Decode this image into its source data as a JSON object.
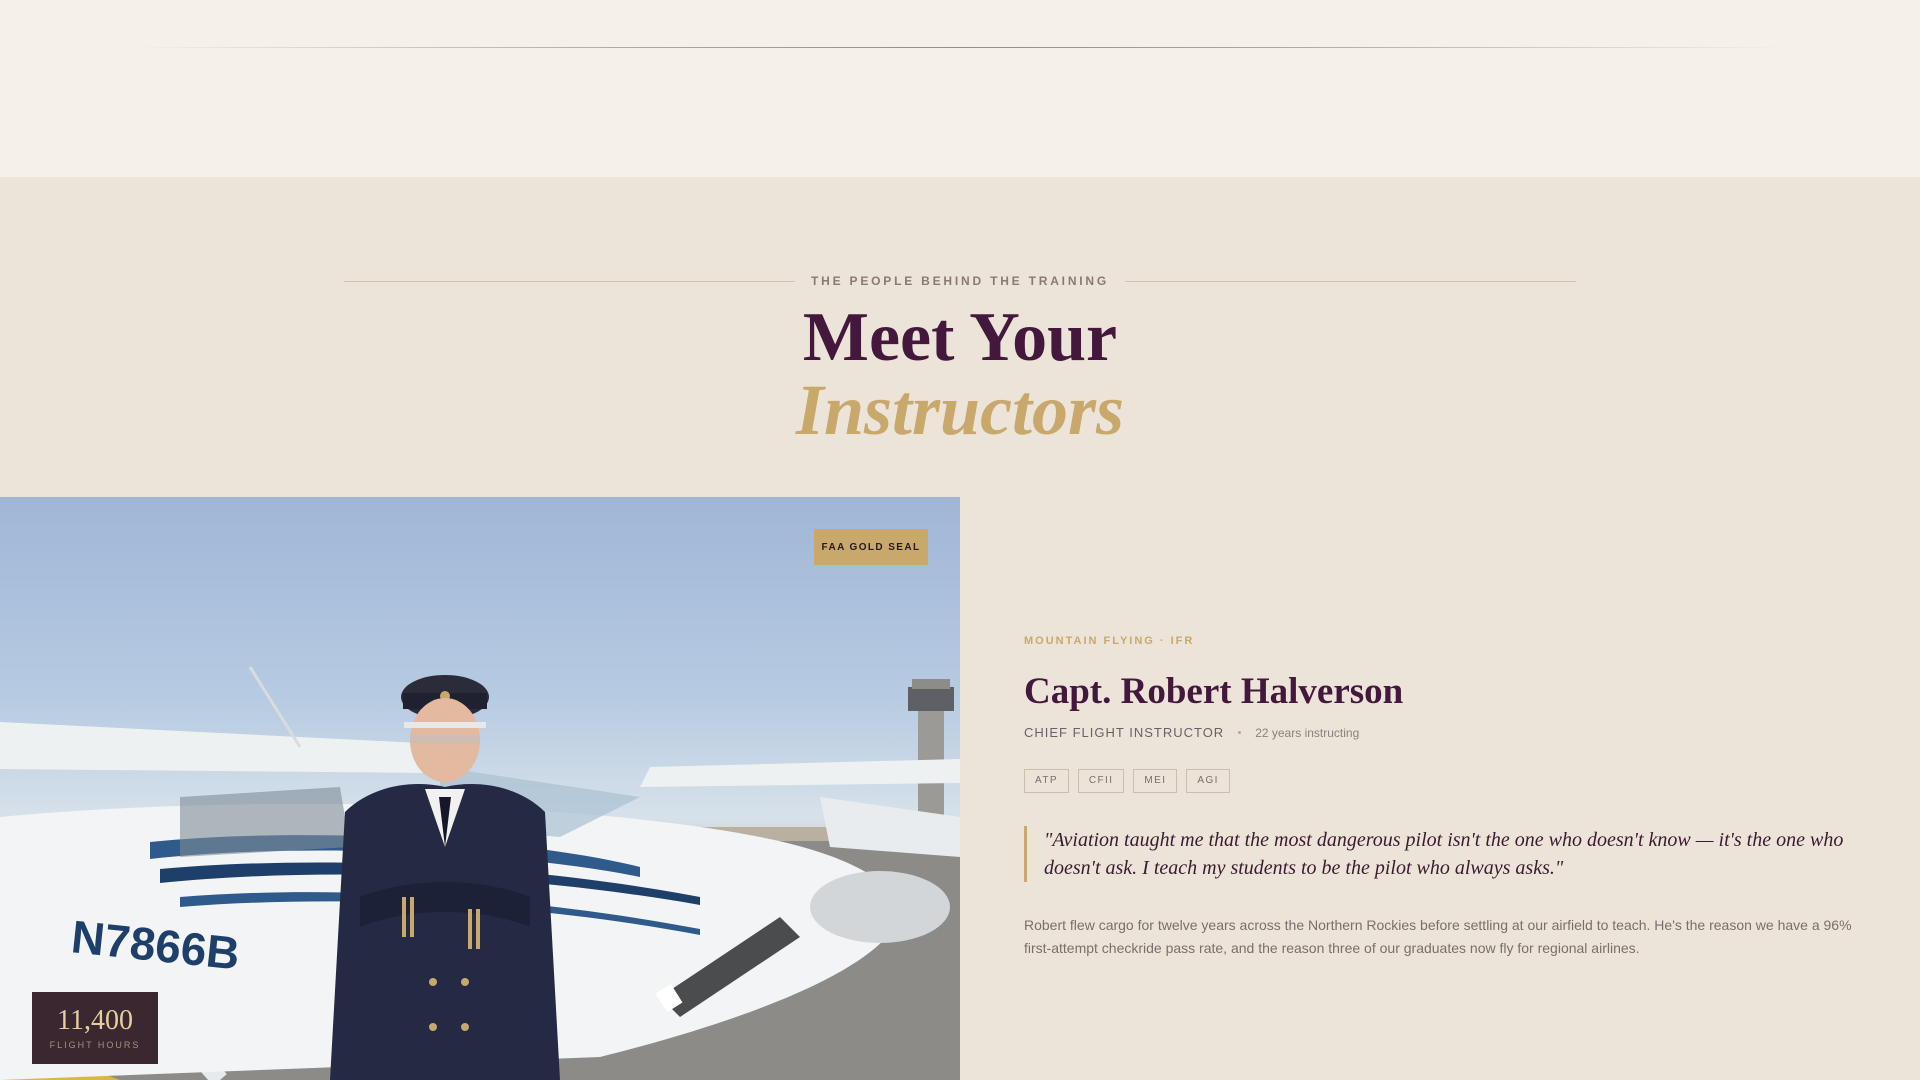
{
  "section": {
    "eyebrow": "THE PEOPLE BEHIND THE TRAINING",
    "title_line1": "Meet Your",
    "title_line2": "Instructors"
  },
  "instructor": {
    "badge": "FAA GOLD SEAL",
    "hours_value": "11,400",
    "hours_label": "FLIGHT HOURS",
    "specialty": "MOUNTAIN FLYING · IFR",
    "name": "Capt. Robert Halverson",
    "role": "CHIEF FLIGHT INSTRUCTOR",
    "years": "22 years instructing",
    "certifications": [
      "ATP",
      "CFII",
      "MEI",
      "AGI"
    ],
    "quote": "\"Aviation taught me that the most dangerous pilot isn't the one who doesn't know — it's the one who doesn't ask. I teach my students to be the pilot who always asks.\"",
    "bio": "Robert flew cargo for twelve years across the Northern Rockies before settling at our airfield to teach. He's the reason we have a 96% first-attempt checkride pass rate, and the reason three of our graduates now fly for regional airlines.",
    "aircraft_registration": "N7866B"
  },
  "colors": {
    "background": "#ece4d8",
    "top_band": "#f5f0ea",
    "plum": "#43183c",
    "gold": "#c9a86b",
    "stat_box": "#3b2730"
  },
  "icons": {
    "photo": "instructor-photo"
  }
}
